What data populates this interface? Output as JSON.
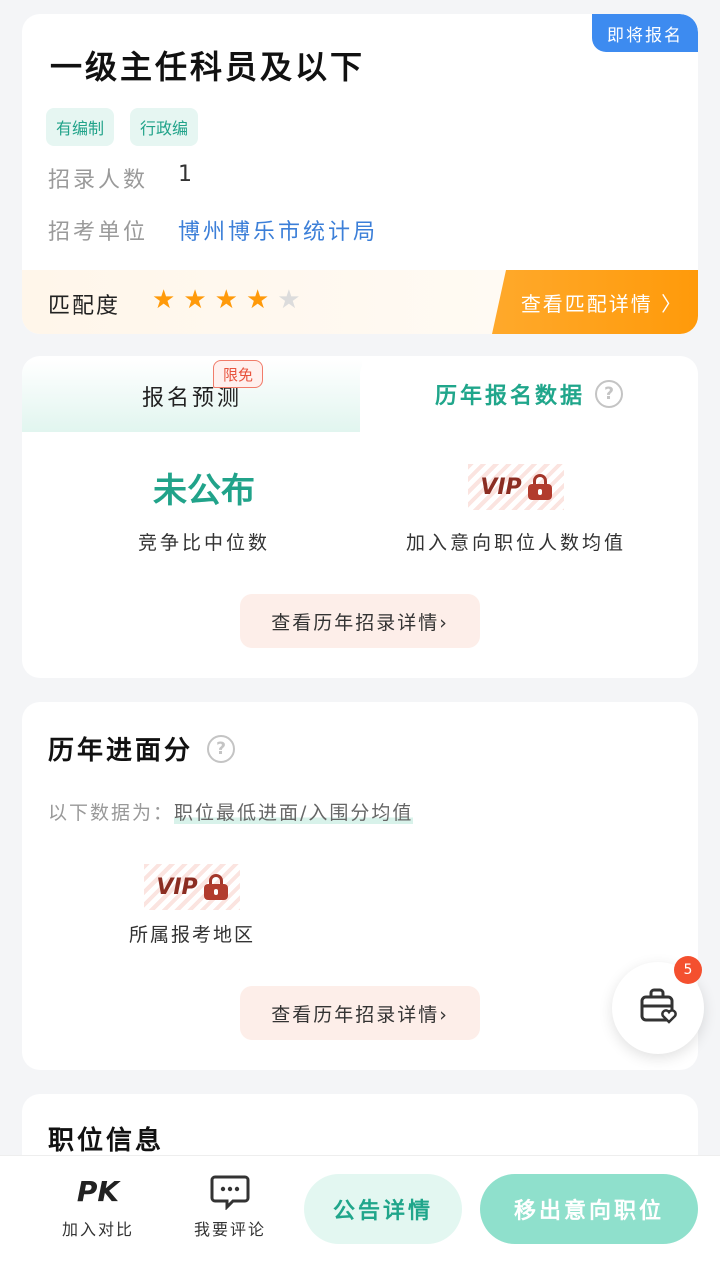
{
  "job": {
    "status_badge": "即将报名",
    "title": "一级主任科员及以下",
    "tags": [
      "有编制",
      "行政编"
    ],
    "recruit_count_label": "招录人数",
    "recruit_count_value": "1",
    "unit_label": "招考单位",
    "unit_value": "博州博乐市统计局",
    "match_label": "匹配度",
    "match_rating": 4,
    "match_max": 5,
    "match_button": "查看匹配详情 〉"
  },
  "signup": {
    "tab_predict": "报名预测",
    "tab_predict_badge": "限免",
    "tab_history": "历年报名数据",
    "median_value": "未公布",
    "median_label": "竞争比中位数",
    "avg_vip": "VIP",
    "avg_label": "加入意向职位人数均值",
    "detail_button": "查看历年招录详情›"
  },
  "scores": {
    "title": "历年进面分",
    "note_prefix": "以下数据为：",
    "note_highlight": "职位最低进面/入围分均值",
    "region_vip": "VIP",
    "region_label": "所属报考地区",
    "detail_button": "查看历年招录详情›"
  },
  "position_info": {
    "title": "职位信息"
  },
  "float_bag": {
    "count": "5",
    "icon": "briefcase-heart-icon"
  },
  "bottom_bar": {
    "pk_icon_text": "PK",
    "pk_label": "加入对比",
    "comment_label": "我要评论",
    "notice_button": "公告详情",
    "remove_button": "移出意向职位"
  },
  "colors": {
    "accent_green": "#20a68b",
    "badge_blue": "#3d8bf0",
    "orange": "#ff9a0a",
    "link_blue": "#3c7fd8"
  }
}
